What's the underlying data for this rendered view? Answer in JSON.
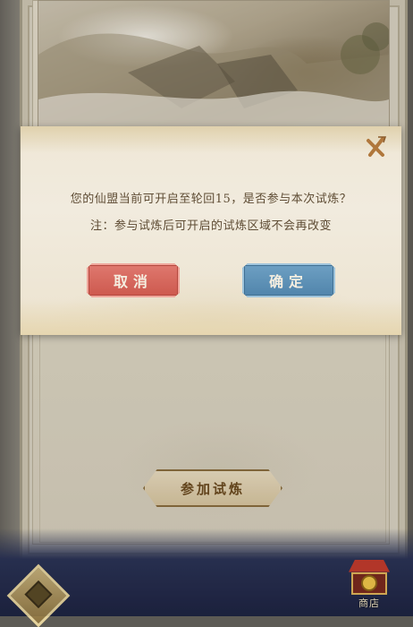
{
  "background": {
    "join_button_label": "参加试炼",
    "shop_label": "商店"
  },
  "dialog": {
    "message": "您的仙盟当前可开启至轮回15，是否参与本次试炼？",
    "note": "注：参与试炼后可开启的试炼区域不会再改变",
    "cancel_label": "取消",
    "confirm_label": "确定",
    "close_icon": "close-x-icon"
  },
  "colors": {
    "cancel": "#cc574c",
    "confirm": "#4f83aa",
    "text": "#5e4c34",
    "close": "#b0773c"
  }
}
